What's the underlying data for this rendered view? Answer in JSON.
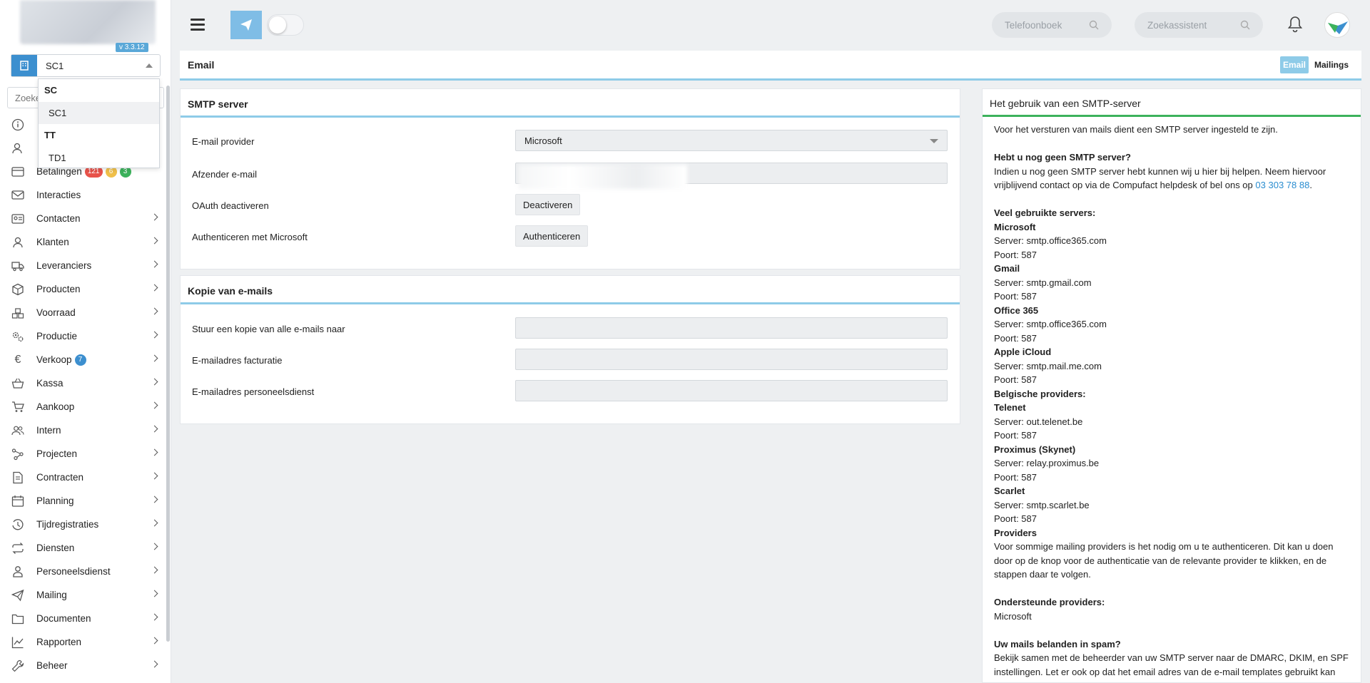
{
  "sidebar": {
    "version": "v 3.3.12",
    "company_selected": "SC1",
    "search_placeholder": "Zoeken...",
    "dropdown": [
      {
        "group": "SC",
        "items": [
          "SC1"
        ]
      },
      {
        "group": "TT",
        "items": [
          "TD1"
        ]
      }
    ],
    "nav": [
      {
        "label": "Betalingen",
        "icon": "payment-icon",
        "badges": [
          "121",
          "6",
          "3"
        ]
      },
      {
        "label": "Interacties",
        "icon": "interaction-icon"
      },
      {
        "label": "Contacten",
        "icon": "contacts-icon"
      },
      {
        "label": "Klanten",
        "icon": "customer-icon"
      },
      {
        "label": "Leveranciers",
        "icon": "truck-icon"
      },
      {
        "label": "Producten",
        "icon": "box-icon"
      },
      {
        "label": "Voorraad",
        "icon": "stock-icon"
      },
      {
        "label": "Productie",
        "icon": "gears-icon"
      },
      {
        "label": "Verkoop",
        "icon": "euro-icon",
        "badges": [
          "7"
        ]
      },
      {
        "label": "Kassa",
        "icon": "basket-icon"
      },
      {
        "label": "Aankoop",
        "icon": "cart-icon"
      },
      {
        "label": "Intern",
        "icon": "users-icon"
      },
      {
        "label": "Projecten",
        "icon": "project-icon"
      },
      {
        "label": "Contracten",
        "icon": "contract-icon"
      },
      {
        "label": "Planning",
        "icon": "calendar-icon"
      },
      {
        "label": "Tijdregistraties",
        "icon": "clock-icon"
      },
      {
        "label": "Diensten",
        "icon": "repeat-icon"
      },
      {
        "label": "Personeelsdienst",
        "icon": "person-icon"
      },
      {
        "label": "Mailing",
        "icon": "paper-plane-icon"
      },
      {
        "label": "Documenten",
        "icon": "folder-icon"
      },
      {
        "label": "Rapporten",
        "icon": "chart-icon"
      },
      {
        "label": "Beheer",
        "icon": "wrench-icon"
      }
    ]
  },
  "topbar": {
    "phonebook_placeholder": "Telefoonboek",
    "assistant_placeholder": "Zoekassistent"
  },
  "page": {
    "title": "Email",
    "tabs": [
      "Email",
      "Mailings"
    ]
  },
  "smtp": {
    "title": "SMTP server",
    "provider_label": "E-mail provider",
    "provider_value": "Microsoft",
    "sender_label": "Afzender e-mail",
    "oauth_label": "OAuth deactiveren",
    "oauth_button": "Deactiveren",
    "auth_label": "Authenticeren met Microsoft",
    "auth_button": "Authenticeren"
  },
  "copy": {
    "title": "Kopie van e-mails",
    "copy_all_label": "Stuur een kopie van alle e-mails naar",
    "billing_label": "E-mailadres facturatie",
    "hr_label": "E-mailadres personeelsdienst"
  },
  "help": {
    "title": "Het gebruik van een SMTP-server",
    "intro": "Voor het versturen van mails dient een SMTP server ingesteld te zijn.",
    "no_server_heading": "Hebt u nog geen SMTP server?",
    "no_server_text": "Indien u nog geen SMTP server hebt kunnen wij u hier bij helpen. Neem hiervoor vrijblijvend contact op via de Compufact helpdesk of bel ons op",
    "phone": "03 303 78 88",
    "period": ".",
    "servers_heading": "Veel gebruikte servers:",
    "servers": [
      {
        "name": "Microsoft",
        "server": "Server: smtp.office365.com",
        "port": "Poort: 587"
      },
      {
        "name": "Gmail",
        "server": "Server: smtp.gmail.com",
        "port": "Poort: 587"
      },
      {
        "name": "Office 365",
        "server": "Server: smtp.office365.com",
        "port": "Poort: 587"
      },
      {
        "name": "Apple iCloud",
        "server": "Server: smtp.mail.me.com",
        "port": "Poort: 587"
      }
    ],
    "belgian_heading": "Belgische providers:",
    "belgian": [
      {
        "name": "Telenet",
        "server": "Server: out.telenet.be",
        "port": "Poort: 587"
      },
      {
        "name": "Proximus (Skynet)",
        "server": "Server: relay.proximus.be",
        "port": "Poort: 587"
      },
      {
        "name": "Scarlet",
        "server": "Server: smtp.scarlet.be",
        "port": "Poort: 587"
      }
    ],
    "providers_heading": "Providers",
    "providers_text": "Voor sommige mailing providers is het nodig om u te authenticeren. Dit kan u doen door op de knop voor de authenticatie van de relevante provider te klikken, en de stappen daar te volgen.",
    "supported_heading": "Ondersteunde providers:",
    "supported_value": "Microsoft",
    "spam_heading": "Uw mails belanden in spam?",
    "spam_text": "Bekijk samen met de beheerder van uw SMTP server naar de DMARC, DKIM, en SPF instellingen. Let er ook op dat het email adres van de e-mail templates gebruikt kan"
  }
}
